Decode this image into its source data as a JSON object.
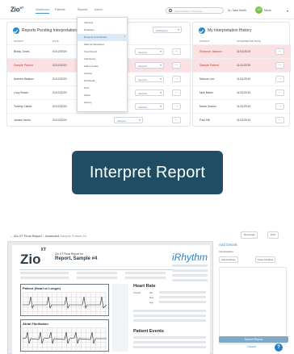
{
  "nav": {
    "logo": "Zio",
    "logo_sup": "XT",
    "tabs": [
      "Dashboard",
      "Patients",
      "Reports",
      "Admin"
    ],
    "search_placeholder": "Search Patient, Physician...",
    "user_name": "Dr. Jane Smith",
    "avatar_initials": "JS",
    "user_sub": "Menu"
  },
  "pending": {
    "title": "Reports Pending Interpretation",
    "filter": "All Reports",
    "columns": [
      "Patient",
      "Date"
    ],
    "rows": [
      {
        "name": "Brady Jones",
        "date": "01/12/2020",
        "action": "Interpret",
        "urgent": false
      },
      {
        "name": "Sample Patient",
        "date": "01/12/2020",
        "action": "Interpret",
        "urgent": true
      },
      {
        "name": "Andrew Watson",
        "date": "01/12/2020",
        "action": "Interpret",
        "urgent": false
      },
      {
        "name": "Lucy Brown",
        "date": "01/12/2020",
        "action": "Interpret",
        "urgent": false
      },
      {
        "name": "Tommy Clarke",
        "date": "01/12/2020",
        "action": "Interpret",
        "urgent": false
      },
      {
        "name": "James Harris",
        "date": "01/12/2020",
        "action": "Interpret",
        "urgent": false
      }
    ]
  },
  "menu": {
    "items": [
      "Interpret",
      "Reassign",
      "Request Amendment",
      "Mark as Reviewed",
      "View Report",
      "Add Notes",
      "Add to Folder",
      "Archive",
      "Download",
      "Print",
      "Share",
      "History"
    ],
    "highlight_index": 2
  },
  "history": {
    "title": "My Interpretation History",
    "columns": [
      "Patient",
      "Interpreted Date"
    ],
    "rows": [
      {
        "name": "Shannon Jackson",
        "date": "11/11/2019",
        "urgent": true
      },
      {
        "name": "Sample Patient",
        "date": "11/11/2019",
        "urgent": true
      },
      {
        "name": "Marcus Lee",
        "date": "11/11/2019",
        "urgent": false
      },
      {
        "name": "Nick Baker",
        "date": "11/11/2019",
        "urgent": false
      },
      {
        "name": "Maria Gomez",
        "date": "11/11/2019",
        "urgent": false
      },
      {
        "name": "Paul Hill",
        "date": "11/11/2019",
        "urgent": false
      }
    ]
  },
  "cta": {
    "label": "Interpret Report"
  },
  "viewer": {
    "back_label": "← Zio XT Final Report – Amended",
    "back_sub": "Sample Patient #4",
    "download_label": "Download",
    "print_label": "Print",
    "report": {
      "logo": "Zio",
      "logo_sup": "XT",
      "subtitle": "Zio XT Final Report for",
      "title": "Report, Sample #4",
      "brand": "iRhythm",
      "section_ecg": "Patient (Heart or Longer)",
      "section_af": "Atrial Fibrillation",
      "hr_title": "Heart Rate",
      "events_title": "Patient Events",
      "hr_rows": [
        "Overall",
        "Min",
        "Max",
        "Avg"
      ]
    },
    "side": {
      "title": "Add Details",
      "label": "Interpretation",
      "btn1": "Add Findings",
      "btn2": "Clear Findings",
      "submit": "Submit Report",
      "cancel": "Cancel",
      "help": "?"
    }
  }
}
